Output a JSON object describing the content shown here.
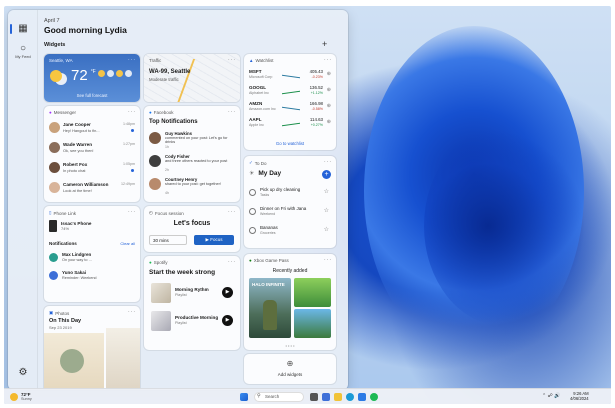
{
  "greeting": {
    "date": "April 7",
    "hello": "Good morning Lydia"
  },
  "rail": {
    "myfeed": "My Feed"
  },
  "widgets_title": "Widgets",
  "weather": {
    "location": "Seattle, WA",
    "temp": "72",
    "unit": "°F",
    "link": "See full forecast"
  },
  "traffic": {
    "app": "Traffic",
    "route": "WA-99, Seattle",
    "status": "Moderate traffic"
  },
  "watchlist": {
    "app": "Watchlist",
    "link": "Go to watchlist",
    "rows": [
      {
        "sym": "MSFT",
        "name": "Microsoft Corp",
        "price": "405.43",
        "change": "-0.23%"
      },
      {
        "sym": "GOOGL",
        "name": "Alphabet Inc",
        "price": "136.52",
        "change": "+1.12%"
      },
      {
        "sym": "AMZN",
        "name": "Amazon.com Inc",
        "price": "166.98",
        "change": "-0.58%"
      },
      {
        "sym": "AAPL",
        "name": "Apple Inc",
        "price": "114.63",
        "change": "+0.27%"
      }
    ]
  },
  "messenger": {
    "app": "Messenger",
    "rows": [
      {
        "name": "Jane Cooper",
        "msg": "Hey! Hangout to fin...",
        "time": "1:48pm"
      },
      {
        "name": "Wade Warren",
        "msg": "Ok, see you then!",
        "time": "1:27pm"
      },
      {
        "name": "Robert Fox",
        "msg": "In photo chat",
        "time": "1:05pm"
      },
      {
        "name": "Cameron Williamson",
        "msg": "Look at the time!",
        "time": "12:49pm"
      }
    ]
  },
  "facebook": {
    "app": "Facebook",
    "title": "Top Notifications",
    "rows": [
      {
        "name": "Guy Hawkins",
        "msg": "commented on your post: Let's go for drinks",
        "time": "1h"
      },
      {
        "name": "Cody Fisher",
        "msg": "and three others reacted to your post",
        "time": "2h"
      },
      {
        "name": "Courtney Henry",
        "msg": "shared to your post: get together!",
        "time": "4h"
      }
    ]
  },
  "todo": {
    "app": "To Do",
    "list": "My Day",
    "rows": [
      {
        "task": "Pick up dry cleaning",
        "sub": "Tasks"
      },
      {
        "task": "Dinner on Fri with Jana",
        "sub": "Weekend"
      },
      {
        "task": "Bananas",
        "sub": "Groceries"
      }
    ]
  },
  "phone": {
    "app": "Phone Link",
    "device": "Issac's Phone",
    "battery": "74%",
    "notif": "Notifications",
    "clear": "Clear all",
    "rows": [
      {
        "name": "Max Lindgren",
        "msg": "On your way to ..."
      },
      {
        "name": "Yuno Sakai",
        "msg": "Reminder: Weekend"
      }
    ]
  },
  "focus": {
    "app": "Focus session",
    "title": "Let's focus",
    "mins": "30 mins",
    "btn": "Focus"
  },
  "spotify": {
    "app": "Spotify",
    "title": "Start the week strong",
    "rows": [
      {
        "name": "Morning Rythm",
        "sub": "Playlist"
      },
      {
        "name": "Productive Morning",
        "sub": "Playlist"
      }
    ]
  },
  "xbox": {
    "app": "Xbox Game Pass",
    "title": "Recently added",
    "game": "HALO INFINITE"
  },
  "photos": {
    "app": "Photos",
    "title": "On This Day",
    "date": "Sep 23 2019"
  },
  "addwidgets": "Add widgets",
  "taskbar": {
    "temp": "72°F",
    "cond": "Sunny",
    "search": "Search",
    "time": "9:26 AM",
    "date": "4/06/2024"
  },
  "colors": {
    "accent": "#2563d8",
    "weather_top": "#3a6fc2",
    "focus_btn": "#1f63c4"
  }
}
